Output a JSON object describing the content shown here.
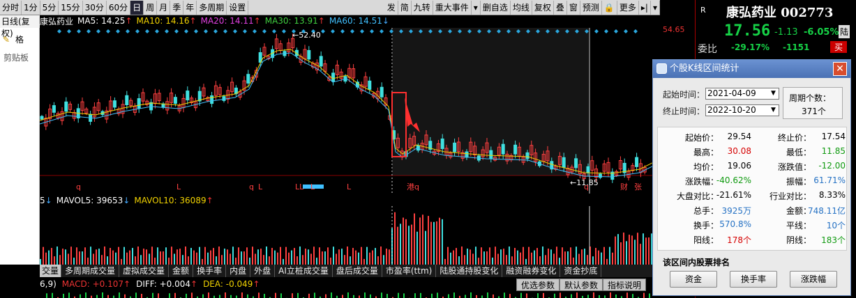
{
  "toolbar": {
    "items": [
      "分时",
      "1分",
      "5分",
      "15分",
      "30分",
      "60分",
      "日",
      "周",
      "月",
      "季",
      "年",
      "多周期",
      "设置",
      "发",
      "简",
      "九转",
      "重大事件",
      "▾",
      "删自选",
      "均线",
      "复权",
      "叠",
      "窗",
      "预测",
      "🔒",
      "更多",
      "▸|",
      "▾"
    ],
    "active_index": 6
  },
  "office": {
    "top": "日线(复权)",
    "format": "格",
    "clipboard": "剪贴板"
  },
  "kline_header": {
    "stock": "康弘药业",
    "ma5": "MA5: 14.25",
    "ma10": "MA10: 14.16",
    "ma20": "MA20: 14.11",
    "ma30": "MA30: 13.91",
    "ma60": "MA60: 14.51",
    "colors": {
      "ma5": "#ffffff",
      "ma10": "#f2d300",
      "ma20": "#e040e0",
      "ma30": "#40d040",
      "ma60": "#40c0ff"
    }
  },
  "kline": {
    "high_label": "←52.40",
    "low_label": "←11.85",
    "markers": [
      "q",
      "L",
      "q",
      "L",
      "LL",
      "L",
      "L",
      "港q",
      "q",
      "财",
      "张"
    ],
    "axis_top": "54.65"
  },
  "vol_header": {
    "prefix": "5",
    "mavol5": "MAVOL5: 39653",
    "mavol10": "MAVOL10: 36089"
  },
  "tabs": [
    "交量",
    "多周期成交量",
    "虚拟成交量",
    "金额",
    "换手率",
    "内盘",
    "外盘",
    "AI立桩成交量",
    "盘后成交量",
    "市盈率(ttm)",
    "陆股通持股变化",
    "融资融券变化",
    "资金抄底"
  ],
  "macd_header": {
    "prefix": "6,9)",
    "macd": "MACD: +0.107",
    "diff": "DIFF: +0.004",
    "dea": "DEA: -0.049"
  },
  "macd_buttons": [
    "优选参数",
    "默认参数",
    "指标说明"
  ],
  "quote": {
    "r": "R",
    "name": "康弘药业 002773",
    "price": "17.56",
    "change": "-1.13",
    "pct": "-6.05%",
    "lu": "陆",
    "weibi_label": "委比",
    "weibi_pct": "-29.17%",
    "weibi_num": "-1151",
    "buy": "买",
    "axis": "54.65"
  },
  "dialog": {
    "title": "个股K线区间统计",
    "start_label": "起始时间：",
    "start_value": "2021-04-09",
    "end_label": "终止时间：",
    "end_value": "2022-10-20",
    "cycle_label": "周期个数：",
    "cycle_value": "371个",
    "rows": [
      {
        "k1": "起始价：",
        "v1": "29.54",
        "k2": "终止价：",
        "v2": "17.54",
        "c1": "",
        "c2": ""
      },
      {
        "k1": "最高：",
        "v1": "30.08",
        "k2": "最低：",
        "v2": "11.85",
        "c1": "red",
        "c2": "green"
      },
      {
        "k1": "均价：",
        "v1": "19.06",
        "k2": "涨跌值：",
        "v2": "-12.00",
        "c1": "",
        "c2": "green"
      },
      {
        "k1": "涨跌幅：",
        "v1": "-40.62%",
        "k2": "振幅：",
        "v2": "61.71%",
        "c1": "green",
        "c2": "blue"
      },
      {
        "k1": "大盘对比：",
        "v1": "-21.61%",
        "k2": "行业对比：",
        "v2": "8.33%",
        "c1": "",
        "c2": ""
      },
      {
        "k1": "总手：",
        "v1": "3925万",
        "k2": "金额：",
        "v2": "748.11亿",
        "c1": "blue",
        "c2": "blue"
      },
      {
        "k1": "换手：",
        "v1": "570.8%",
        "k2": "平线：",
        "v2": "10个",
        "c1": "blue",
        "c2": "blue"
      },
      {
        "k1": "阳线：",
        "v1": "178个",
        "k2": "阴线：",
        "v2": "183个",
        "c1": "red",
        "c2": "green"
      }
    ],
    "rank_label": "该区间内股票排名",
    "buttons": [
      "资金",
      "换手率",
      "涨跌幅"
    ]
  }
}
